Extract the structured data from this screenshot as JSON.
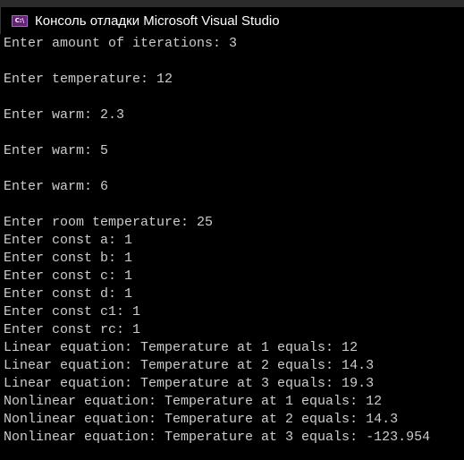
{
  "window": {
    "title": "Консоль отладки Microsoft Visual Studio",
    "icon": "console-app-icon",
    "icon_text": "C:\\"
  },
  "console": {
    "lines": [
      "Enter amount of iterations: 3",
      "",
      "Enter temperature: 12",
      "",
      "Enter warm: 2.3",
      "",
      "Enter warm: 5",
      "",
      "Enter warm: 6",
      "",
      "Enter room temperature: 25",
      "Enter const a: 1",
      "Enter const b: 1",
      "Enter const c: 1",
      "Enter const d: 1",
      "Enter const c1: 1",
      "Enter const rc: 1",
      "Linear equation: Temperature at 1 equals: 12",
      "Linear equation: Temperature at 2 equals: 14.3",
      "Linear equation: Temperature at 3 equals: 19.3",
      "Nonlinear equation: Temperature at 1 equals: 12",
      "Nonlinear equation: Temperature at 2 equals: 14.3",
      "Nonlinear equation: Temperature at 3 equals: -123.954"
    ]
  }
}
